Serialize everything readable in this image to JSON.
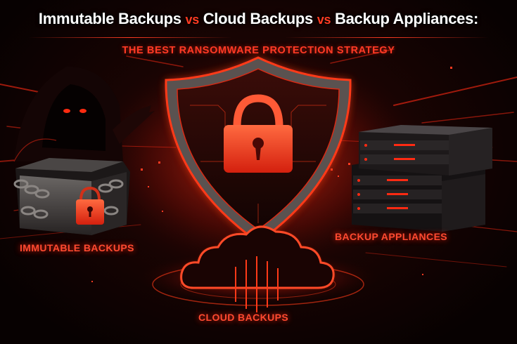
{
  "header": {
    "title_part1": "Immutable Backups",
    "vs1": "vs",
    "title_part2": "Cloud Backups",
    "vs2": "vs",
    "title_part3": "Backup Appliances:",
    "subtitle": "THE BEST RANSOMWARE PROTECTION STRATEGY"
  },
  "labels": {
    "immutable": "IMMUTABLE BACKUPS",
    "appliances": "BACKUP APPLIANCES",
    "cloud": "CLOUD BACKUPS"
  },
  "colors": {
    "accent": "#ff3b22",
    "background": "#0a0303",
    "title": "#ffffff"
  },
  "icons": [
    "hooded-hacker-icon",
    "shield-padlock-icon",
    "chained-drive-icon",
    "server-rack-icon",
    "cloud-icon"
  ]
}
